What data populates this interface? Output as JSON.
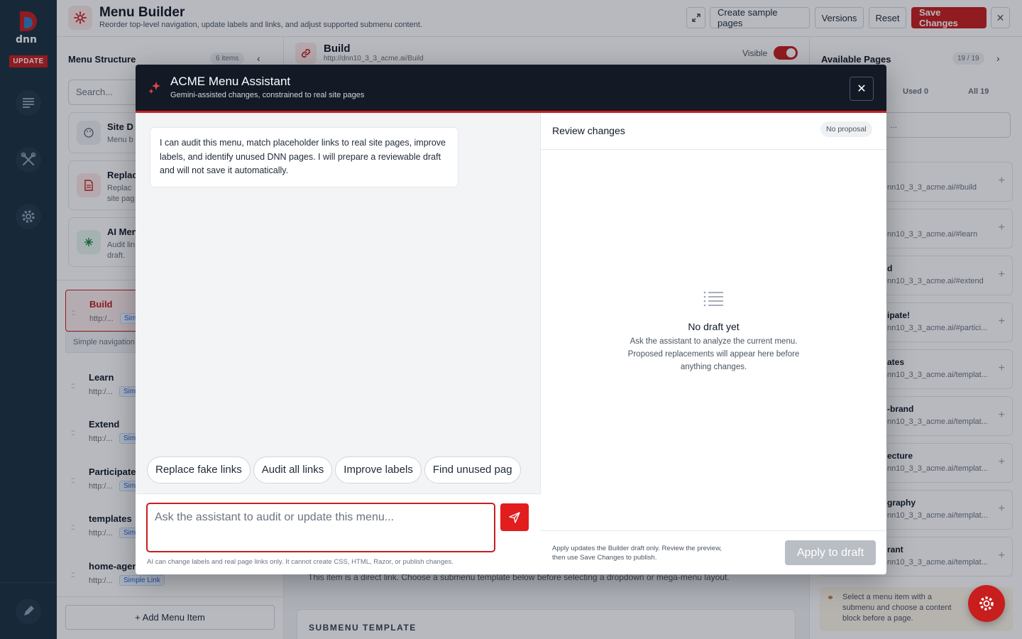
{
  "rail": {
    "update_label": "UPDATE",
    "colors": {
      "background": "#1b3140",
      "accent": "#c81e1e"
    }
  },
  "header": {
    "title": "Menu Builder",
    "subtitle": "Reorder top-level navigation, update labels and links, and adjust supported submenu content.",
    "buttons": {
      "create_sample": "Create sample pages",
      "versions": "Versions",
      "reset": "Reset",
      "save": "Save Changes"
    }
  },
  "menu_structure": {
    "title": "Menu Structure",
    "count": "6 items",
    "search_placeholder": "Search...",
    "tools": [
      {
        "title": "Site D",
        "desc": "Menu b"
      },
      {
        "title": "Replac",
        "desc": "Replac\nsite pag"
      },
      {
        "title": "AI Men",
        "desc": "Audit lin\ndraft."
      }
    ],
    "items": [
      {
        "name": "Build",
        "url": "http:/...",
        "tag": "Sim"
      },
      {
        "name": "Learn",
        "url": "http:/...",
        "tag": "Sim"
      },
      {
        "name": "Extend",
        "url": "http:/...",
        "tag": "Sim"
      },
      {
        "name": "Participate",
        "url": "http:/...",
        "tag": "Sim"
      },
      {
        "name": "templates",
        "url": "http:/...",
        "tag": "Sim"
      },
      {
        "name": "home-agen",
        "url": "http:/...",
        "tag": "Simple Link"
      }
    ],
    "selected_note": "Simple navigation",
    "add_label": "+ Add Menu Item"
  },
  "editor": {
    "item_name": "Build",
    "item_url": "http://dnn10_3_3_acme.ai/Build",
    "visible_label": "Visible",
    "direct_link_note": "This item is a direct link. Choose a submenu template below before selecting a dropdown or mega-menu layout.",
    "submenu_template_label": "SUBMENU TEMPLATE"
  },
  "available_pages": {
    "title": "Available Pages",
    "count": "19 / 19",
    "tabs": {
      "used": "Used 0",
      "all": "All 19"
    },
    "search_placeholder": "...",
    "pages": [
      {
        "name": "",
        "url": "nn10_3_3_acme.ai/#build"
      },
      {
        "name": "",
        "url": "nn10_3_3_acme.ai/#learn"
      },
      {
        "name": "d",
        "url": "nn10_3_3_acme.ai/#extend"
      },
      {
        "name": "ipate!",
        "url": "nn10_3_3_acme.ai/#partici..."
      },
      {
        "name": "ates",
        "url": "nn10_3_3_acme.ai/templat..."
      },
      {
        "name": "-brand",
        "url": "nn10_3_3_acme.ai/templat..."
      },
      {
        "name": "ecture",
        "url": "nn10_3_3_acme.ai/templat..."
      },
      {
        "name": "graphy",
        "url": "nn10_3_3_acme.ai/templat..."
      },
      {
        "name": "rant",
        "url": "nn10_3_3_acme.ai/templat..."
      }
    ],
    "tip": "Select a menu item with a submenu and choose a content block before a page."
  },
  "assistant": {
    "title": "ACME Menu Assistant",
    "subtitle": "Gemini-assisted changes, constrained to real site pages",
    "welcome": "I can audit this menu, match placeholder links to real site pages, improve labels, and identify unused DNN pages. I will prepare a reviewable draft and will not save it automatically.",
    "suggestions": [
      "Replace fake links",
      "Audit all links",
      "Improve labels",
      "Find unused pag"
    ],
    "input_placeholder": "Ask the assistant to audit or update this menu...",
    "disclaimer": "AI can change labels and real page links only. It cannot create CSS, HTML, Razor, or publish changes.",
    "review": {
      "title": "Review changes",
      "badge": "No proposal",
      "empty_title": "No draft yet",
      "empty_desc": "Ask the assistant to analyze the current menu. Proposed replacements will appear here before anything changes.",
      "footer_note": "Apply updates the Builder draft only. Review the preview, then use Save Changes to publish.",
      "apply_label": "Apply to draft"
    }
  }
}
